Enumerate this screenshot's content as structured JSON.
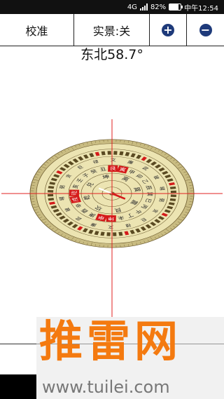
{
  "status_bar": {
    "network": "4G",
    "battery": "82%",
    "battery_level": 0.82,
    "time": "中午12:54"
  },
  "toolbar": {
    "calibrate_label": "校准",
    "live_view_label": "实景:关",
    "zoom_in_symbol": "+",
    "zoom_out_symbol": "−"
  },
  "heading": {
    "text": "东北58.7°",
    "degrees": 58.7
  },
  "compass": {
    "colors": {
      "rim": "#c9bc82",
      "face": "#ece4b2",
      "ring_line": "#6b5a2e",
      "highlight": "#d41a1a",
      "crosshair": "#e02020"
    },
    "rotation_degrees": -58.7,
    "ring_chars": [
      [
        "兑",
        "坤",
        "离",
        "巽",
        "震",
        "艮",
        "坎",
        "乾"
      ],
      [
        "壬",
        "子",
        "癸",
        "丑",
        "艮",
        "寅",
        "甲",
        "卯",
        "乙",
        "辰",
        "巽",
        "巳",
        "丙",
        "午",
        "丁",
        "未",
        "坤",
        "申",
        "庚",
        "酉",
        "辛",
        "戌",
        "乾",
        "亥"
      ],
      [
        "贪",
        "巨",
        "禄",
        "文",
        "廉",
        "武",
        "破",
        "辅",
        "弼",
        "贪",
        "巨",
        "禄",
        "文",
        "廉",
        "武",
        "破",
        "辅",
        "弼"
      ]
    ],
    "highlighted": [
      "坤",
      "申",
      "艮",
      "寅",
      "乾",
      "戌"
    ]
  },
  "watermark": {
    "title": "推雷网",
    "url": "www.tuilei.com"
  }
}
